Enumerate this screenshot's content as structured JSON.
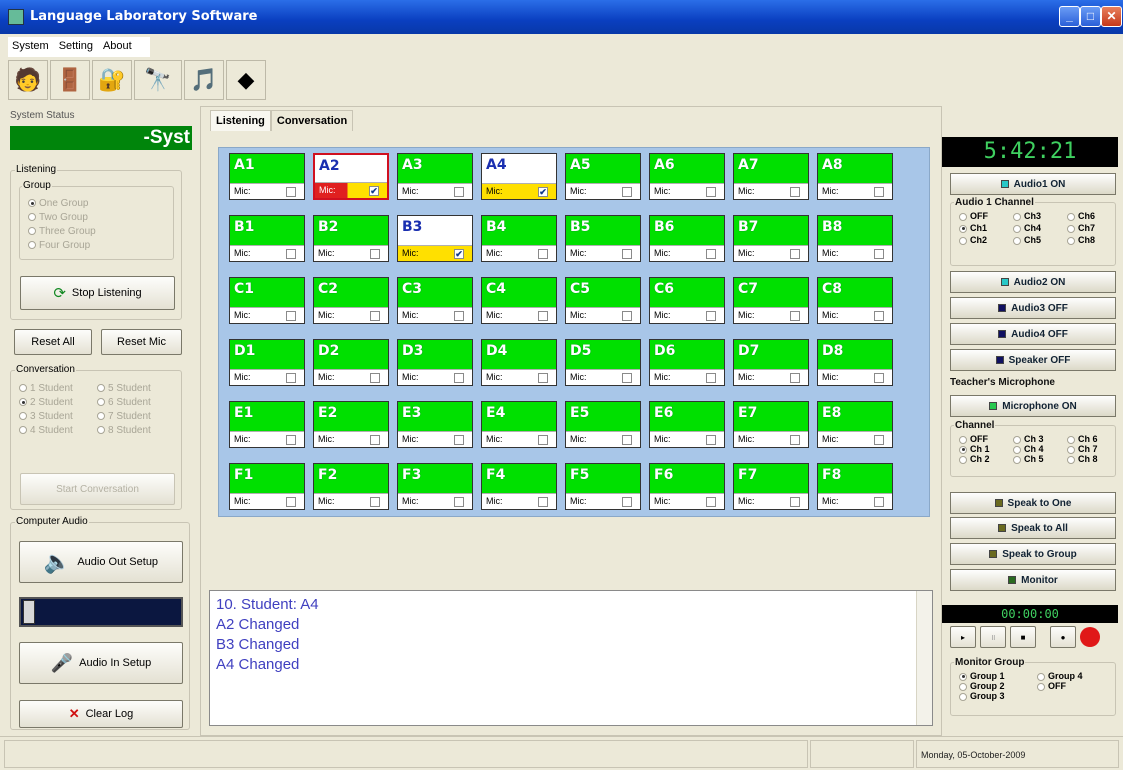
{
  "window": {
    "title": "Language Laboratory Software"
  },
  "menu": [
    "System",
    "Setting",
    "About"
  ],
  "toolbar_icons": [
    "teacher-icon",
    "exit-door-icon",
    "key-lock-icon",
    "binoculars-icon",
    "audio-speaker-icon",
    "disc-icon"
  ],
  "left": {
    "system_status_label": "System Status",
    "system_status_text": "-Syst",
    "listening_label": "Listening",
    "group_label": "Group",
    "group_options": [
      "One Group",
      "Two Group",
      "Three Group",
      "Four Group"
    ],
    "stop_listening": "Stop Listening",
    "reset_all": "Reset All",
    "reset_mic": "Reset Mic",
    "conversation_label": "Conversation",
    "conversation_options": [
      "1 Student",
      "5 Student",
      "2 Student",
      "6 Student",
      "3 Student",
      "7 Student",
      "4 Student",
      "8 Student"
    ],
    "start_conversation": "Start Conversation",
    "computer_audio_label": "Computer Audio",
    "audio_out_setup": "Audio Out Setup",
    "audio_in_setup": "Audio In Setup",
    "clear_log": "Clear Log"
  },
  "tabs": [
    "Listening",
    "Conversation"
  ],
  "students": {
    "rows": [
      "A",
      "B",
      "C",
      "D",
      "E",
      "F"
    ],
    "cols": 8,
    "mic_label": "Mic:",
    "selected_red": [
      "A2"
    ],
    "selected_yellow": [
      "A4",
      "B3"
    ],
    "mic_checked": [
      "A2",
      "A4",
      "B3"
    ]
  },
  "log": [
    "10. Student: A4",
    "A2 Changed",
    "B3 Changed",
    "A4 Changed"
  ],
  "right": {
    "clock": "5:42:21",
    "audio1_btn": "Audio1 ON",
    "audio1_channel_label": "Audio 1 Channel",
    "audio1_channels": [
      "OFF",
      "Ch3",
      "Ch6",
      "Ch1",
      "Ch4",
      "Ch7",
      "Ch2",
      "Ch5",
      "Ch8"
    ],
    "audio2_btn": "Audio2 ON",
    "audio3_btn": "Audio3 OFF",
    "audio4_btn": "Audio4 OFF",
    "speaker_btn": "Speaker OFF",
    "teacher_mic_label": "Teacher's Microphone",
    "microphone_btn": "Microphone ON",
    "channel_label": "Channel",
    "channels": [
      "OFF",
      "Ch 3",
      "Ch 6",
      "Ch 1",
      "Ch 4",
      "Ch 7",
      "Ch 2",
      "Ch 5",
      "Ch 8"
    ],
    "speak_to_one": "Speak to One",
    "speak_to_all": "Speak to All",
    "speak_to_group": "Speak to Group",
    "monitor": "Monitor",
    "timer": "00:00:00",
    "monitor_group_label": "Monitor Group",
    "monitor_groups": [
      "Group 1",
      "Group 4",
      "Group 2",
      "OFF",
      "Group 3"
    ]
  },
  "status": {
    "date": "Monday, 05-October-2009"
  },
  "colors": {
    "active": "#00e000",
    "selected_red": "#e02020",
    "selected_yellow": "#ffe000",
    "title_blue": "#0a3fc0"
  }
}
